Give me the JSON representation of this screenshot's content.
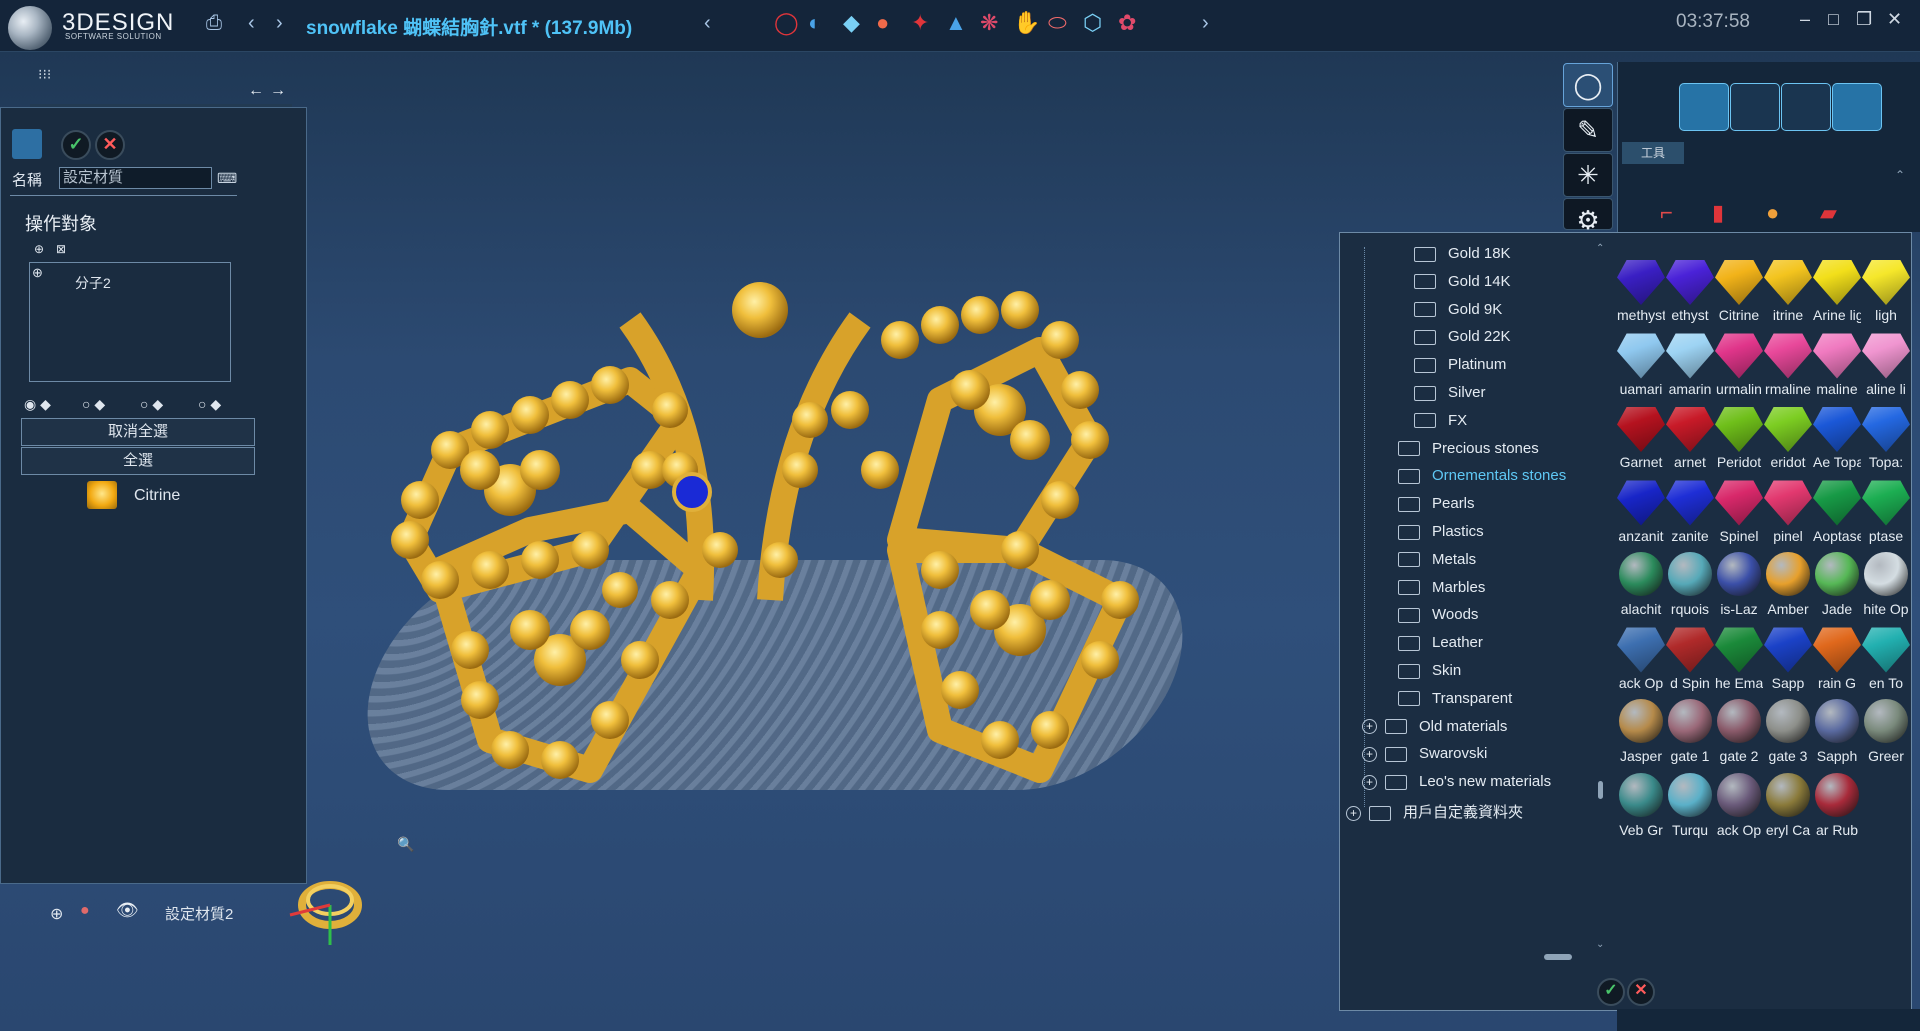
{
  "app": {
    "logo_text": "3DESIGN",
    "logo_sub": "SOFTWARE SOLUTION"
  },
  "title": {
    "file": "snowflake 蝴蝶結胸針.vtf *",
    "size": "(137.9Mb)"
  },
  "clock": "03:37:58",
  "left_panel": {
    "name_label": "名稱",
    "name_value": "設定材質",
    "section_title": "操作對象",
    "object_item": "分子2",
    "deselect_all": "取消全選",
    "select_all": "全選",
    "material": "Citrine"
  },
  "status": {
    "layer_label": "設定材質2"
  },
  "tooltip": "工具",
  "tree": [
    {
      "label": "Gold 18K",
      "level": 2
    },
    {
      "label": "Gold 14K",
      "level": 2
    },
    {
      "label": "Gold 9K",
      "level": 2
    },
    {
      "label": "Gold 22K",
      "level": 2
    },
    {
      "label": "Platinum",
      "level": 2
    },
    {
      "label": "Silver",
      "level": 2
    },
    {
      "label": "FX",
      "level": 2
    },
    {
      "label": "Precious stones",
      "level": 1
    },
    {
      "label": "Ornementals stones",
      "level": 1,
      "selected": true
    },
    {
      "label": "Pearls",
      "level": 1
    },
    {
      "label": "Plastics",
      "level": 1
    },
    {
      "label": "Metals",
      "level": 1
    },
    {
      "label": "Marbles",
      "level": 1
    },
    {
      "label": "Woods",
      "level": 1
    },
    {
      "label": "Leather",
      "level": 1
    },
    {
      "label": "Skin",
      "level": 1
    },
    {
      "label": "Transparent",
      "level": 1
    },
    {
      "label": "Old materials",
      "level": 0,
      "expandable": true
    },
    {
      "label": "Swarovski",
      "level": 0,
      "expandable": true
    },
    {
      "label": "Leo's new materials",
      "level": 0,
      "expandable": true
    },
    {
      "label": "用戶自定義資料夾",
      "level": -1,
      "expandable": true
    }
  ],
  "swatch_rows": [
    {
      "kind": "gem",
      "items": [
        {
          "label": "methyst",
          "color": "#3a1fc4"
        },
        {
          "label": "ethyst",
          "color": "#4a22d8"
        },
        {
          "label": "Citrine",
          "color": "#f2b319"
        },
        {
          "label": "itrine",
          "color": "#f3c41e"
        },
        {
          "label": "Arine ligne",
          "color": "#f2df1a"
        },
        {
          "label": "ligh",
          "color": "#f5e72a"
        }
      ]
    },
    {
      "kind": "gem",
      "items": [
        {
          "label": "uamari",
          "color": "#8fc8ef"
        },
        {
          "label": "amarin",
          "color": "#9dd3f3"
        },
        {
          "label": "urmalin",
          "color": "#e0358a"
        },
        {
          "label": "rmaline",
          "color": "#e8489a"
        },
        {
          "label": "maline",
          "color": "#f07ac0"
        },
        {
          "label": "aline li",
          "color": "#f095d0"
        }
      ]
    },
    {
      "kind": "gem",
      "items": [
        {
          "label": "Garnet",
          "color": "#b5121f"
        },
        {
          "label": "arnet",
          "color": "#c81a28"
        },
        {
          "label": "Peridot",
          "color": "#6fbf1a"
        },
        {
          "label": "eridot",
          "color": "#7ccd22"
        },
        {
          "label": "Ae Topa",
          "color": "#1b58d8"
        },
        {
          "label": "Topa:",
          "color": "#2468e2"
        }
      ]
    },
    {
      "kind": "gem",
      "items": [
        {
          "label": "anzanit",
          "color": "#1825c8"
        },
        {
          "label": "zanite",
          "color": "#1e2ed6"
        },
        {
          "label": "Spinel",
          "color": "#d8286a"
        },
        {
          "label": "pinel",
          "color": "#e2386f"
        },
        {
          "label": "Aoptase",
          "color": "#179a46"
        },
        {
          "label": "ptase",
          "color": "#1cae52"
        }
      ]
    },
    {
      "kind": "ball",
      "items": [
        {
          "label": "alachit",
          "color": "#2b8b5c"
        },
        {
          "label": "rquois",
          "color": "#56a9b8"
        },
        {
          "label": "is-Laz",
          "color": "#3b4fa8"
        },
        {
          "label": "Amber",
          "color": "#e7a02c"
        },
        {
          "label": "Jade",
          "color": "#56b856"
        },
        {
          "label": "hite Op",
          "color": "#d4dde2"
        }
      ]
    },
    {
      "kind": "gem",
      "items": [
        {
          "label": "ack Op",
          "color": "#3d6fb0"
        },
        {
          "label": "d Spin",
          "color": "#b02a2a"
        },
        {
          "label": "he Ema",
          "color": "#1b8a3a"
        },
        {
          "label": "Sapp",
          "color": "#1b42c8"
        },
        {
          "label": "rain G",
          "color": "#e0681c"
        },
        {
          "label": "en To",
          "color": "#22b0b0"
        }
      ]
    },
    {
      "kind": "ball",
      "items": [
        {
          "label": "Jasper",
          "color": "#b58a4a"
        },
        {
          "label": "gate 1",
          "color": "#9a6878"
        },
        {
          "label": "gate 2",
          "color": "#8a5a6a"
        },
        {
          "label": "gate 3",
          "color": "#8d8f8a"
        },
        {
          "label": "Sapph",
          "color": "#5a6aa0"
        },
        {
          "label": "Greer",
          "color": "#7a8a7c"
        }
      ]
    },
    {
      "kind": "ball",
      "items": [
        {
          "label": "Veb Gr",
          "color": "#3a8a8a"
        },
        {
          "label": "Turqu",
          "color": "#5ab0c8"
        },
        {
          "label": "ack Op",
          "color": "#6a5a7a"
        },
        {
          "label": "eryl Ca",
          "color": "#8a7a3a"
        },
        {
          "label": "ar Rub",
          "color": "#a82a3a"
        }
      ]
    }
  ],
  "colors": {
    "accent": "#4fc3f7",
    "panel": "#1b2d42",
    "gold": "#e9b53a"
  }
}
